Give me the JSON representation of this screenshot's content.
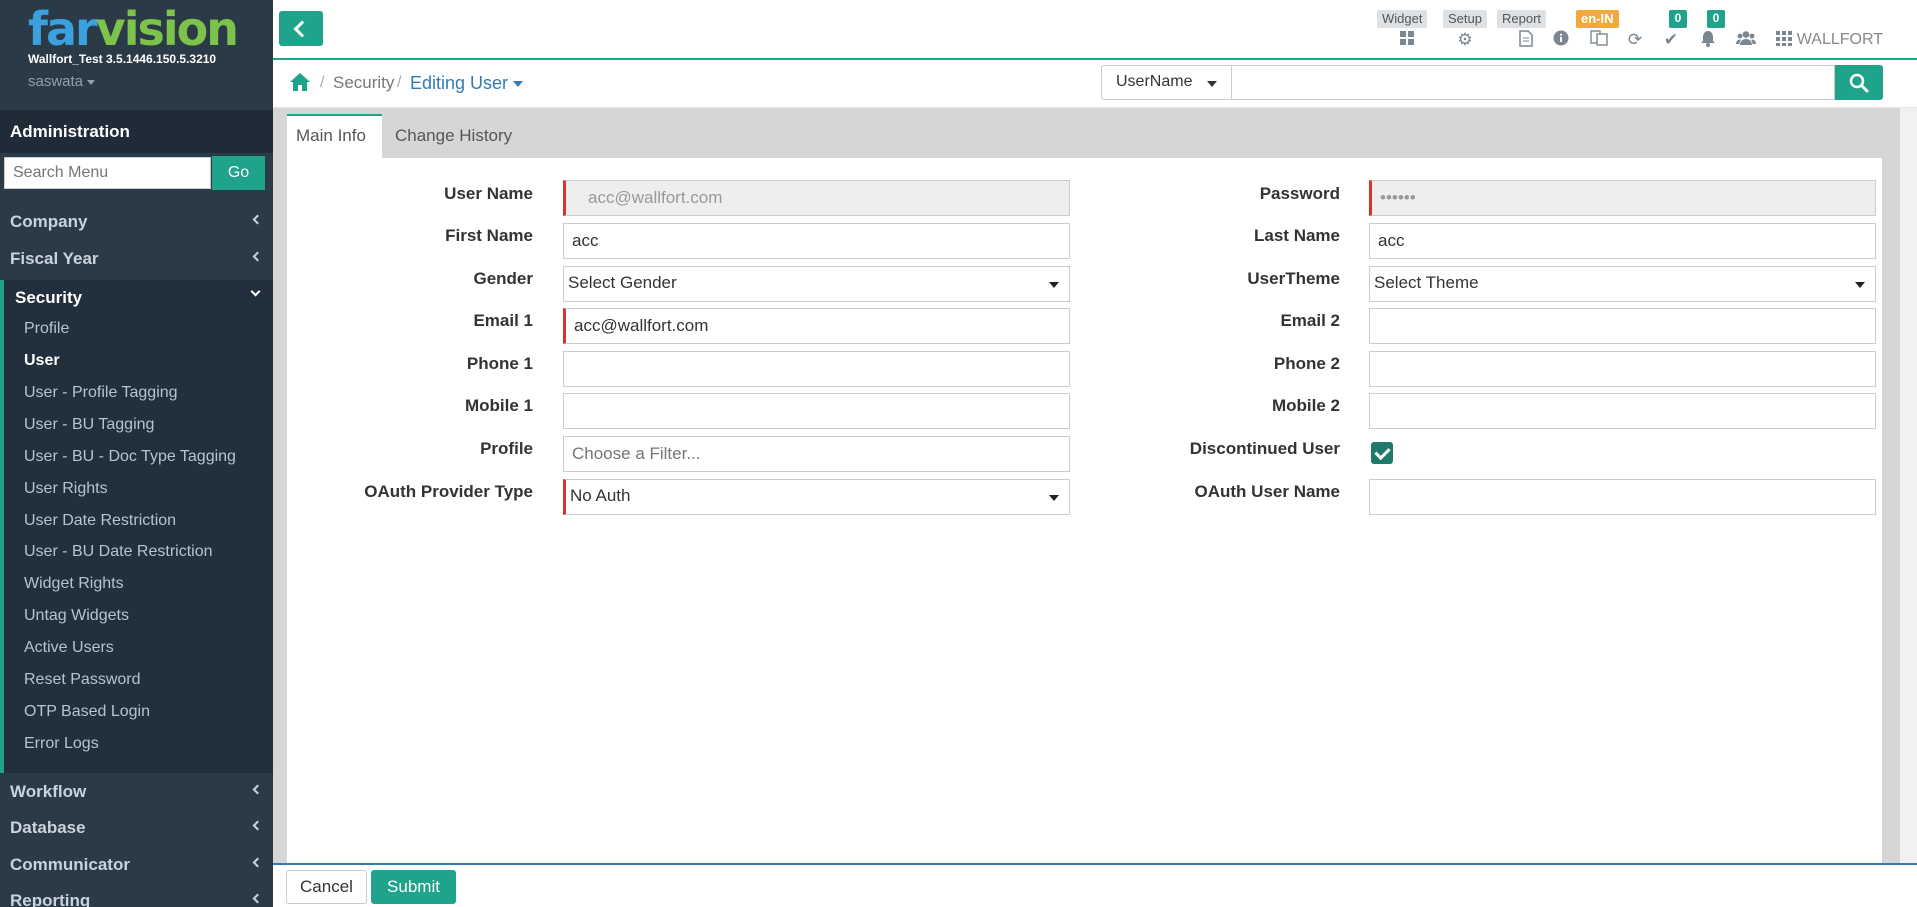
{
  "brand": {
    "logo_far": "far",
    "logo_vision": "vision",
    "version": "Wallfort_Test 3.5.1446.150.5.3210",
    "username": "saswata",
    "colors": {
      "accent": "#1fa38a",
      "sidebar": "#2b3a47",
      "required": "#d9342b",
      "link": "#337ab7"
    }
  },
  "sidebar": {
    "header": "Administration",
    "search_placeholder": "Search Menu",
    "go_label": "Go",
    "items_top": [
      {
        "label": "Company"
      },
      {
        "label": "Fiscal Year"
      }
    ],
    "security": {
      "label": "Security",
      "subitems": [
        {
          "label": "Profile"
        },
        {
          "label": "User"
        },
        {
          "label": "User - Profile Tagging"
        },
        {
          "label": "User - BU Tagging"
        },
        {
          "label": "User - BU - Doc Type Tagging"
        },
        {
          "label": "User Rights"
        },
        {
          "label": "User Date Restriction"
        },
        {
          "label": "User - BU Date Restriction"
        },
        {
          "label": "Widget Rights"
        },
        {
          "label": "Untag Widgets"
        },
        {
          "label": "Active Users"
        },
        {
          "label": "Reset Password"
        },
        {
          "label": "OTP Based Login"
        },
        {
          "label": "Error Logs"
        }
      ]
    },
    "items_bottom": [
      {
        "label": "Workflow"
      },
      {
        "label": "Database"
      },
      {
        "label": "Communicator"
      },
      {
        "label": "Reporting"
      }
    ]
  },
  "topbar": {
    "widget": "Widget",
    "setup": "Setup",
    "report": "Report",
    "lang": "en-IN",
    "tasks_count": "0",
    "notif_count": "0",
    "company": "WALLFORT",
    "icons": [
      "widget-grid-icon",
      "gear-icon",
      "document-icon",
      "info-icon",
      "translate-icon",
      "refresh-icon",
      "check-icon",
      "bell-icon",
      "users-icon",
      "apps-grid-icon"
    ]
  },
  "breadcrumb": {
    "section": "Security",
    "page": "Editing User"
  },
  "search": {
    "field": "UserName",
    "value": ""
  },
  "tabs": [
    {
      "label": "Main Info"
    },
    {
      "label": "Change History"
    }
  ],
  "form": {
    "username": {
      "label": "User Name",
      "value": "acc@wallfort.com"
    },
    "password": {
      "label": "Password",
      "value": "••••••"
    },
    "first_name": {
      "label": "First Name",
      "value": "acc"
    },
    "last_name": {
      "label": "Last Name",
      "value": "acc"
    },
    "gender": {
      "label": "Gender",
      "value": "Select Gender"
    },
    "theme": {
      "label": "UserTheme",
      "value": "Select Theme"
    },
    "email1": {
      "label": "Email 1",
      "value": "acc@wallfort.com"
    },
    "email2": {
      "label": "Email 2",
      "value": ""
    },
    "phone1": {
      "label": "Phone 1",
      "value": ""
    },
    "phone2": {
      "label": "Phone 2",
      "value": ""
    },
    "mobile1": {
      "label": "Mobile 1",
      "value": ""
    },
    "mobile2": {
      "label": "Mobile 2",
      "value": ""
    },
    "profile": {
      "label": "Profile",
      "placeholder": "Choose a Filter..."
    },
    "discontinued": {
      "label": "Discontinued User",
      "checked": true
    },
    "oauth_type": {
      "label": "OAuth Provider Type",
      "value": "No Auth"
    },
    "oauth_user": {
      "label": "OAuth User Name",
      "value": ""
    }
  },
  "footer": {
    "cancel": "Cancel",
    "submit": "Submit"
  }
}
